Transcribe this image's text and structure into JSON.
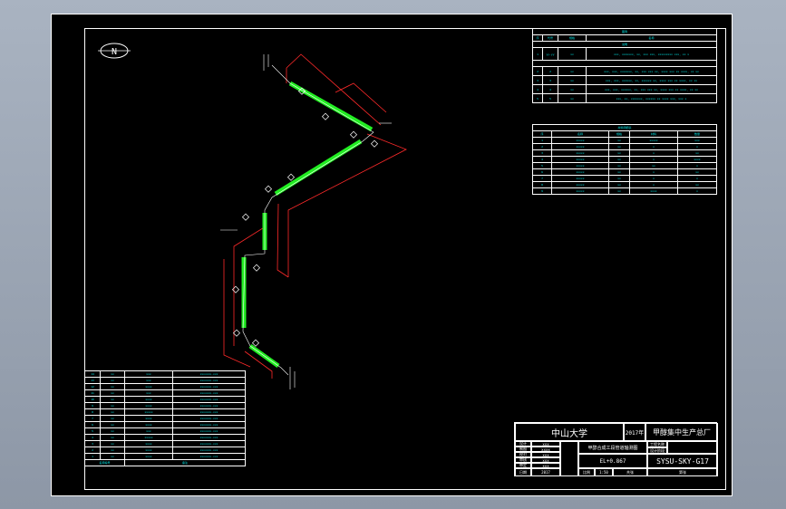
{
  "drawing": {
    "north_label": "N",
    "colors": {
      "pipe": "#22ee22",
      "dim": "#ff2a2a",
      "text": "#ffffff",
      "table": "#00e5e5",
      "sheet": "#000000"
    }
  },
  "legend_table": {
    "title": "图例",
    "header": [
      "序",
      "代号",
      "规格",
      "名称"
    ],
    "sub_title": "说明",
    "rows": [
      [
        "1",
        "yy-yy",
        "xx",
        "xxx, xxxxxxx, xx, xxx xxx, xxxxxxxxx xxx, xx x"
      ],
      [
        "2",
        "2",
        "xx",
        "xxx, xxx, xxxxxxx, xx, xxx xxx xx, xxxx xxx xx xxxx, xx xx"
      ],
      [
        "3",
        "3",
        "xx",
        "xxx, xxx, xxxxxx, xx, xxxxxx xx, xxxx xxx xx xxxx, xx xx"
      ],
      [
        "4",
        "4",
        "xx",
        "xxx, xxx, xxxxxx, xx, xxx xxx xx, xxxx xxx xx xxxx, xx xx"
      ],
      [
        "5",
        "5",
        "xx",
        "xxx, xx, xxxxxxx, xxxxxx xx xxxx xxx, xxx x"
      ]
    ]
  },
  "material_table": {
    "title": "材料明细表",
    "header": [
      "序",
      "名称",
      "规格",
      "材料",
      "数量"
    ],
    "rows": [
      [
        "1",
        "xxxxx",
        "xx",
        "xxxxx",
        "xxx"
      ],
      [
        "2",
        "xxxxx",
        "xx",
        "x",
        "x"
      ],
      [
        "3",
        "xxxxx",
        "xx",
        "x",
        "xx"
      ],
      [
        "4",
        "xxxxx",
        "xx",
        "x",
        "xxxx"
      ],
      [
        "5",
        "xxxxx",
        "xx",
        "xx",
        "x"
      ],
      [
        "6",
        "xxxxx",
        "xx",
        "x",
        "xx"
      ],
      [
        "7",
        "xxxxx",
        "xx",
        "x",
        "x"
      ],
      [
        "8",
        "xxxxx",
        "xx",
        "x",
        "xx"
      ],
      [
        "9",
        "xxxxx",
        "xx",
        "xxxx",
        "x"
      ]
    ]
  },
  "parts_list": {
    "footer": [
      "名称编号",
      "备注"
    ],
    "rows": [
      [
        "14",
        "xx",
        "xxx",
        "xxxxxxx-xxx"
      ],
      [
        "13",
        "xx",
        "xxx",
        "xxxxxxx-xxx"
      ],
      [
        "12",
        "xx",
        "xxxx",
        "xxxxxxx-xxx"
      ],
      [
        "11",
        "xx",
        "xxx",
        "xxxxxxx-xxx"
      ],
      [
        "10",
        "xx",
        "xxxx",
        "xxxxxxx-xxx"
      ],
      [
        "9",
        "xx",
        "xxxx",
        "xxxxxxx-xxx"
      ],
      [
        "8",
        "xx",
        "xxxxx",
        "xxxxxxx-xxx"
      ],
      [
        "7",
        "xx",
        "xxxx",
        "xxxxxxx-xxx"
      ],
      [
        "6",
        "xx",
        "xxxx",
        "xxxxxxx-xxx"
      ],
      [
        "5",
        "xx",
        "xxx",
        "xxxxxxx-xxx"
      ],
      [
        "4",
        "xx",
        "xxxxx",
        "xxxxxxx-xxx"
      ],
      [
        "3",
        "xx",
        "xxxx",
        "xxxxxxx-xxx"
      ],
      [
        "2",
        "xx",
        "xxxx",
        "xxxxxxx-xxx"
      ],
      [
        "1",
        "xx",
        "xxxx",
        "xxxxxxx-xxx"
      ]
    ]
  },
  "title_block": {
    "school": "中山大学",
    "year": "2017年",
    "factory": "甲醇集中生产总厂",
    "drawing_name": "甲醇合成工段管道轴测图",
    "elevation": "EL+0.867",
    "drawing_no": "SYSU-SKY-G17",
    "project": "工程名称",
    "design_stage": "设计阶段",
    "roles": [
      "设计",
      "制图",
      "校对",
      "审核",
      "审定",
      "日期"
    ],
    "names": [
      "xxx",
      "xxxx",
      "xxx",
      "xxx",
      "xxx",
      "2017"
    ],
    "bottom": [
      "比例",
      "1:50",
      "共张",
      "第张"
    ]
  }
}
